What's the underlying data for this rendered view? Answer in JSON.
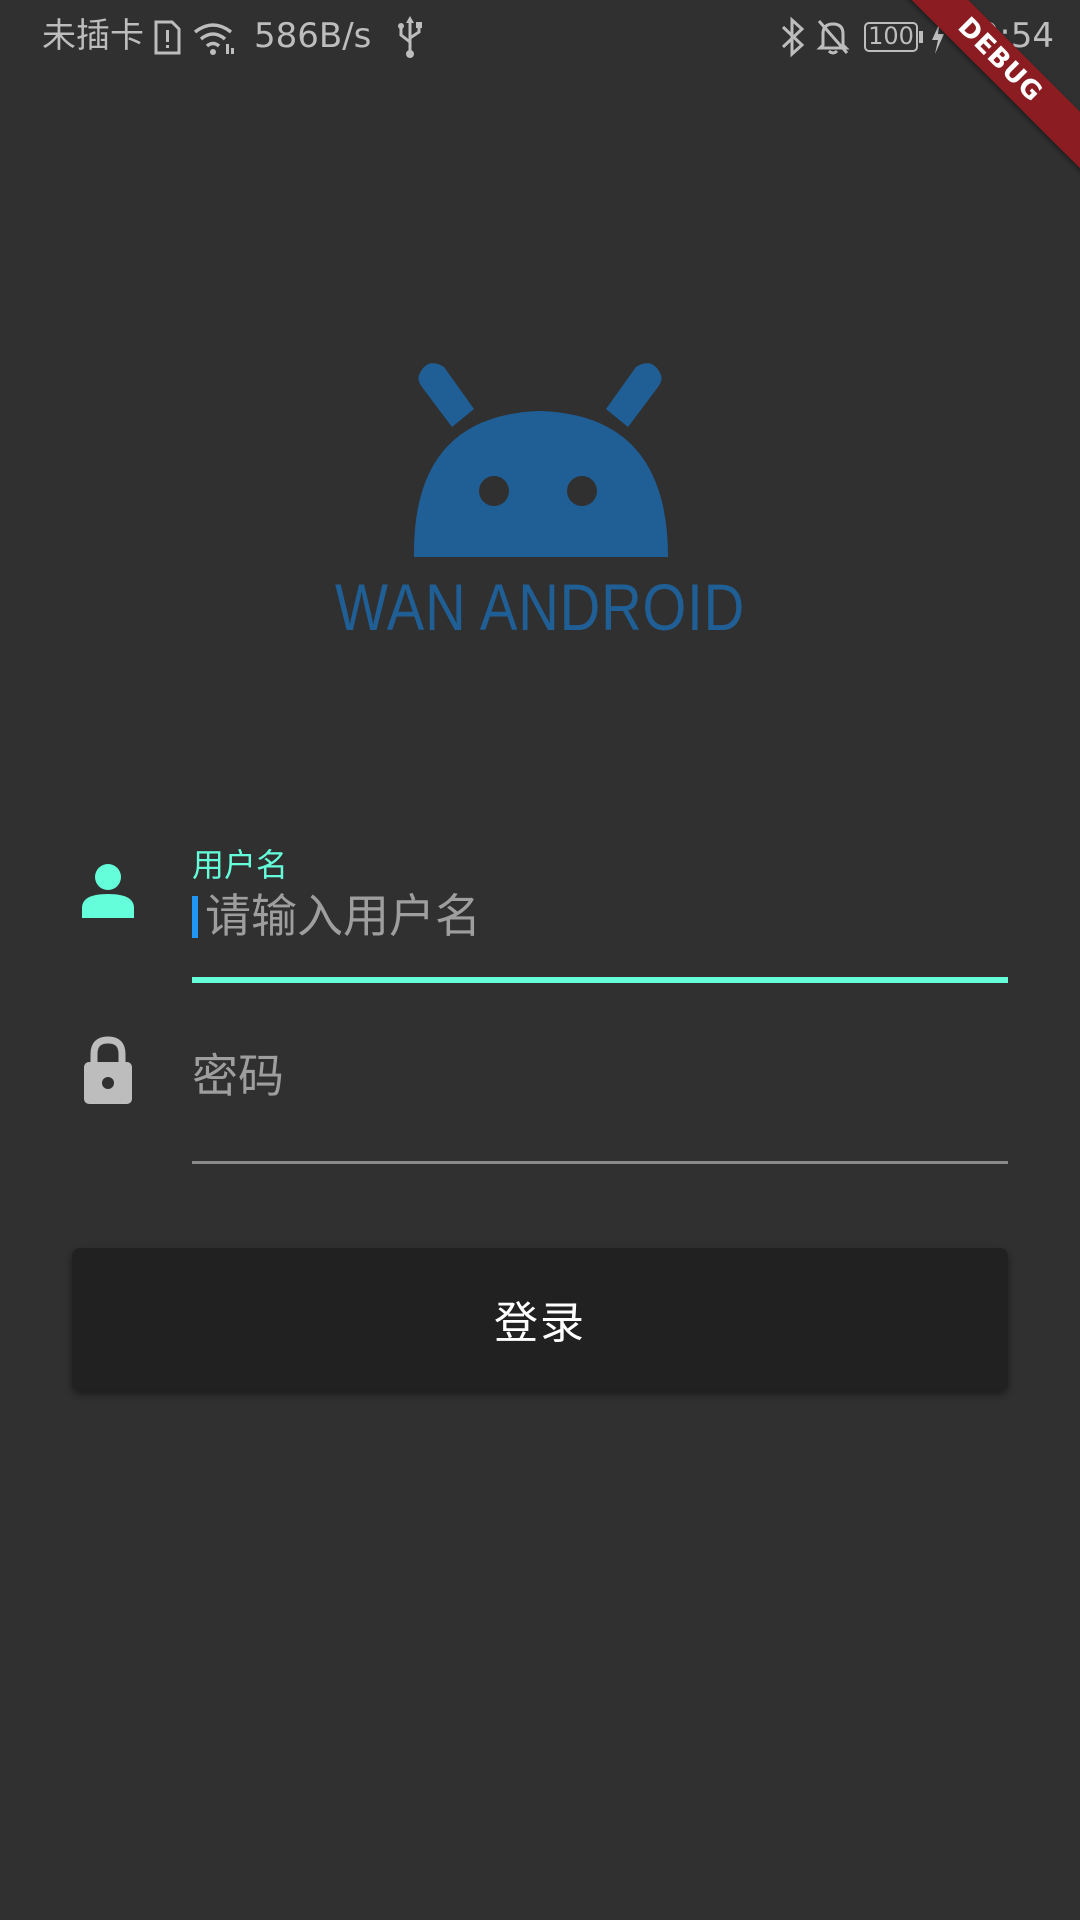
{
  "status_bar": {
    "carrier": "未插卡",
    "net_speed": "586B/s",
    "battery": "100",
    "time": "20:54",
    "icons": [
      "sim-alert-icon",
      "wifi-icon",
      "usb-icon",
      "bluetooth-icon",
      "mute-bell-icon",
      "battery-icon",
      "charging-bolt-icon"
    ]
  },
  "debug_banner": "DEBUG",
  "logo": {
    "text": "WAN ANDROID",
    "color": "#1f5f96"
  },
  "form": {
    "username": {
      "label": "用户名",
      "placeholder": "请输入用户名",
      "icon": "person-icon",
      "icon_color": "#64ffda"
    },
    "password": {
      "placeholder": "密码",
      "icon": "lock-icon",
      "icon_color": "#bdbdbd"
    },
    "login_button": "登录"
  },
  "colors": {
    "background": "#303030",
    "accent": "#64ffda",
    "cursor": "#2196f3",
    "button": "#212121"
  }
}
